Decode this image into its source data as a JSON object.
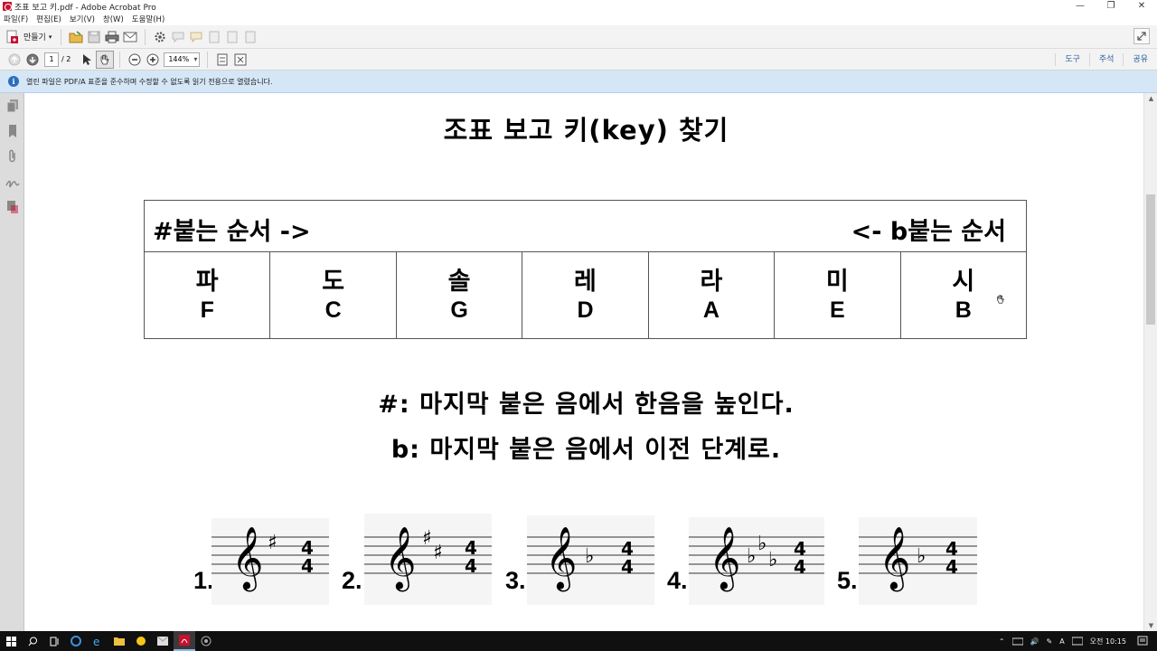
{
  "window": {
    "title": "조표 보고 키.pdf - Adobe Acrobat Pro",
    "controls": [
      "—",
      "❐",
      "✕"
    ]
  },
  "menu": [
    "파일(F)",
    "편집(E)",
    "보기(V)",
    "창(W)",
    "도움말(H)"
  ],
  "toolbar": {
    "create_label": "만들기",
    "expand": "⤢"
  },
  "nav": {
    "page_current": "1",
    "page_total": "/ 2",
    "zoom": "144%",
    "tabs": [
      "도구",
      "주석",
      "공유"
    ]
  },
  "infobar": {
    "message": "열린 파일은 PDF/A 표준을 준수하며 수정할 수 없도록 읽기 전용으로 열렸습니다."
  },
  "document": {
    "title": "조표 보고 키(key) 찾기",
    "table": {
      "header_left": "#붙는 순서 ->",
      "header_right": "<- b붙는 순서",
      "columns": [
        {
          "ko": "파",
          "en": "F"
        },
        {
          "ko": "도",
          "en": "C"
        },
        {
          "ko": "솔",
          "en": "G"
        },
        {
          "ko": "레",
          "en": "D"
        },
        {
          "ko": "라",
          "en": "A"
        },
        {
          "ko": "미",
          "en": "E"
        },
        {
          "ko": "시",
          "en": "B"
        }
      ]
    },
    "rule_sharp": "#: 마지막 붙은 음에서 한음을 높인다.",
    "rule_flat": "b: 마지막 붙은 음에서 이전 단계로.",
    "quiz": [
      {
        "num": "1.",
        "accidentals": [
          "sharp"
        ]
      },
      {
        "num": "2.",
        "accidentals": [
          "sharp",
          "sharp"
        ]
      },
      {
        "num": "3.",
        "accidentals": [
          "flat"
        ]
      },
      {
        "num": "4.",
        "accidentals": [
          "flat",
          "flat",
          "flat"
        ]
      },
      {
        "num": "5.",
        "accidentals": [
          "flat"
        ]
      }
    ],
    "time_signature": [
      "4",
      "4"
    ]
  },
  "taskbar": {
    "ime": "A",
    "clock": "오전 10:15"
  },
  "colors": {
    "infobar_bg": "#d5e7f7",
    "toolbar_bg": "#f3f3f3",
    "taskbar_bg": "#101010",
    "acrobat_red": "#c8102e"
  }
}
